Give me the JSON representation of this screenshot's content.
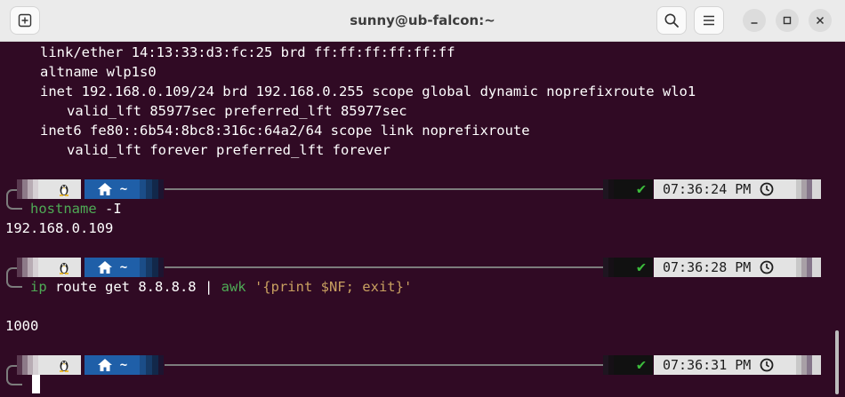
{
  "window": {
    "title": "sunny@ub-falcon:~"
  },
  "titlebar": {
    "new_tab_icon": "new-tab-icon",
    "search_icon": "search-icon",
    "menu_icon": "hamburger-menu-icon",
    "minimize_icon": "minimize-icon",
    "maximize_icon": "maximize-icon",
    "close_icon": "close-icon"
  },
  "output_top": [
    "link/ether 14:13:33:d3:fc:25 brd ff:ff:ff:ff:ff:ff",
    "altname wlp1s0",
    "inet 192.168.0.109/24 brd 192.168.0.255 scope global dynamic noprefixroute wlo1",
    "valid_lft 85977sec preferred_lft 85977sec",
    "inet6 fe80::6b54:8bc8:316c:64a2/64 scope link noprefixroute",
    "valid_lft forever preferred_lft forever"
  ],
  "prompt": {
    "dir": "~",
    "os_icon": "linux-tux-icon",
    "home_icon": "home-icon",
    "status_icon": "checkmark-icon",
    "status_symbol": "✔",
    "clock_icon": "clock-icon"
  },
  "blocks": [
    {
      "time": "07:36:24 PM",
      "command": {
        "cmd": "hostname",
        "args": " -I"
      },
      "output": [
        "192.168.0.109"
      ]
    },
    {
      "time": "07:36:28 PM",
      "command": {
        "cmd": "ip",
        "args": " route get 8.8.8.8 | ",
        "cmd2": "awk",
        "str": " '{print $NF; exit}'"
      },
      "output": [
        "1000"
      ]
    },
    {
      "time": "07:36:31 PM",
      "command": null,
      "output": []
    }
  ],
  "colors": {
    "terminal_bg": "#300a24",
    "command": "#4eaa55",
    "string": "#c8a060",
    "home_segment": "#1f5fa8",
    "ok": "#3cbd3c"
  }
}
